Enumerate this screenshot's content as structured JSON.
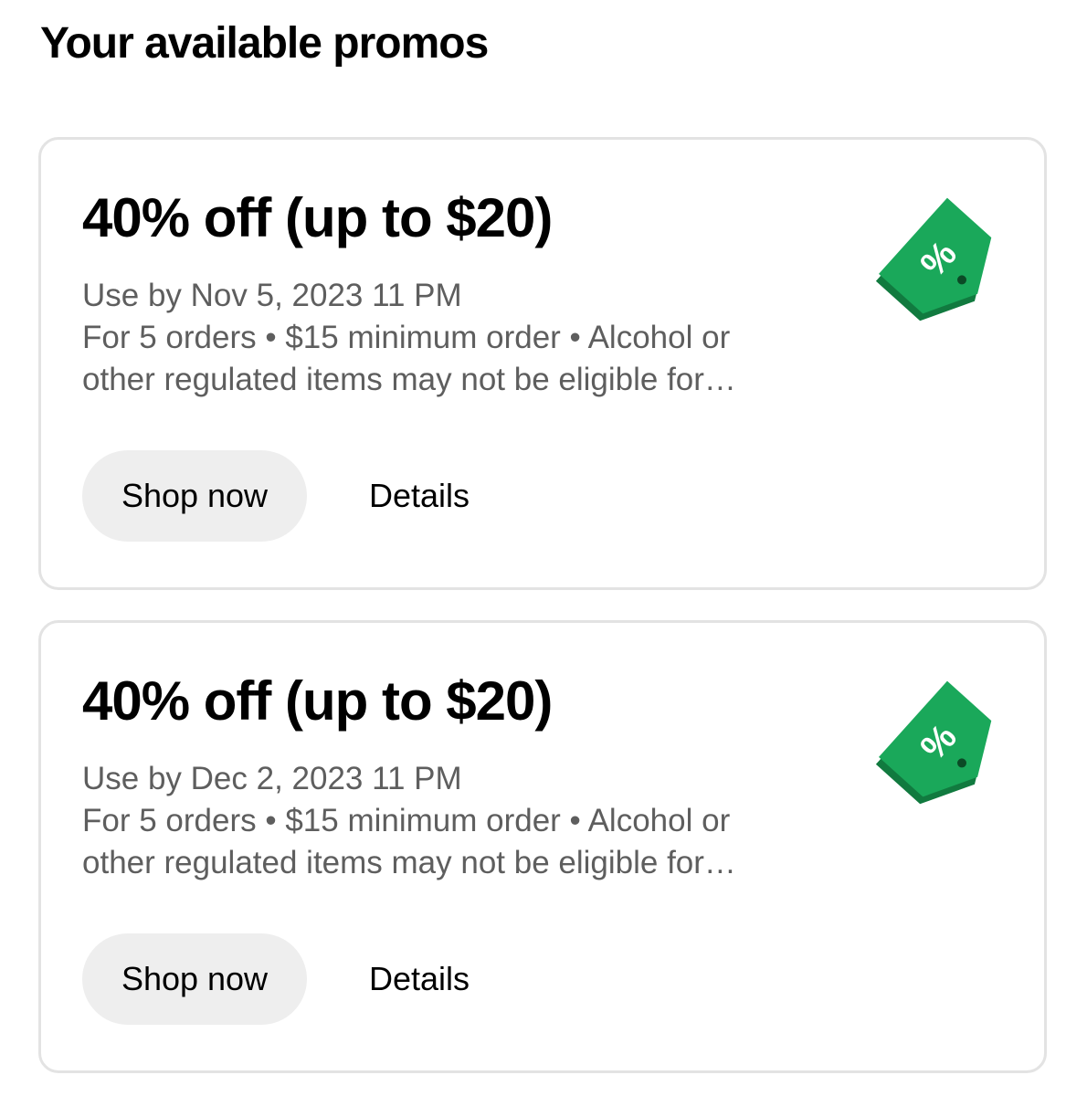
{
  "page": {
    "title": "Your available promos"
  },
  "colors": {
    "tag_green": "#1aa85a",
    "tag_green_dark": "#117a3f",
    "muted_text": "#5e5e5e",
    "button_bg": "#eeeeee"
  },
  "promos": [
    {
      "title": "40% off (up to $20)",
      "use_by": "Use by Nov 5, 2023 11 PM",
      "terms_line1": "For 5 orders • $15 minimum order • Alcohol or",
      "terms_line2": "other regulated items may not be eligible for…",
      "shop_label": "Shop now",
      "details_label": "Details",
      "icon": "percent-tag-icon"
    },
    {
      "title": "40% off (up to $20)",
      "use_by": "Use by Dec 2, 2023 11 PM",
      "terms_line1": "For 5 orders • $15 minimum order • Alcohol or",
      "terms_line2": "other regulated items may not be eligible for…",
      "shop_label": "Shop now",
      "details_label": "Details",
      "icon": "percent-tag-icon"
    }
  ]
}
